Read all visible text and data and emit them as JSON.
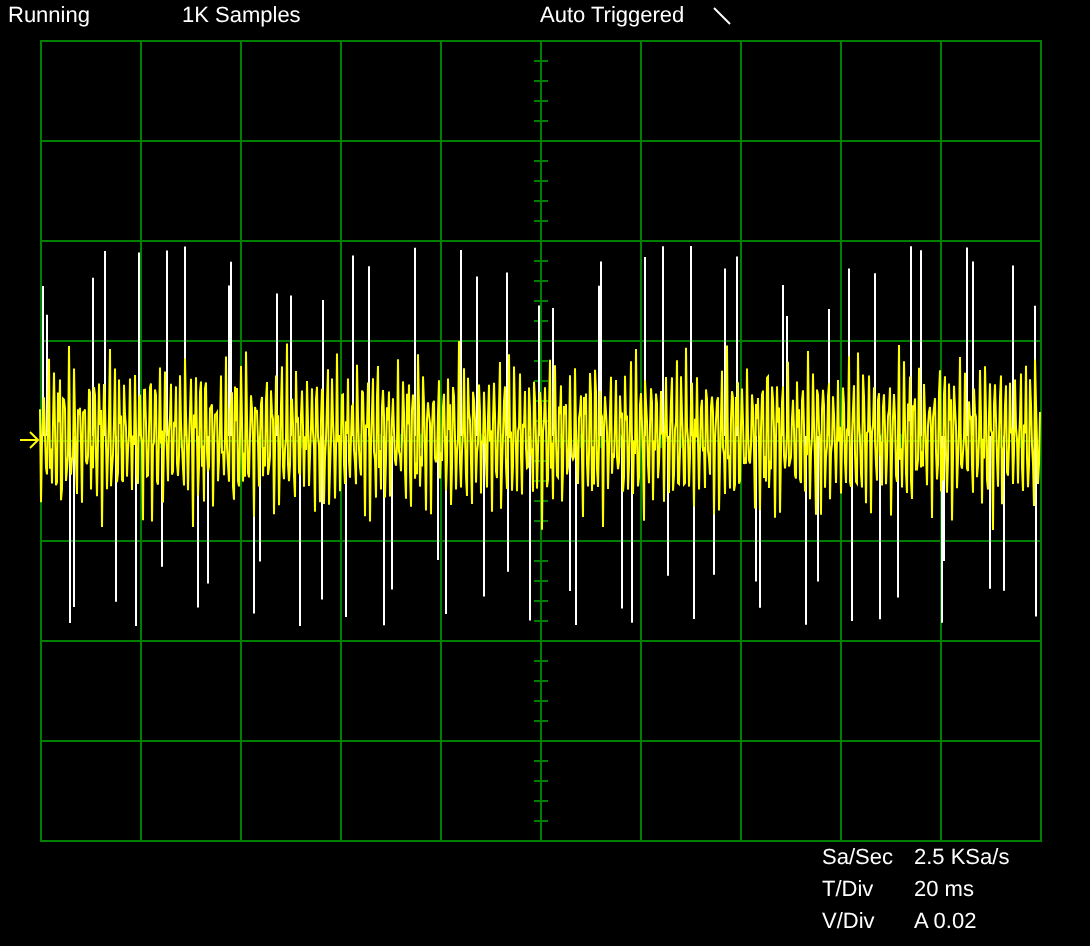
{
  "status_bar": {
    "run_state": "Running",
    "samples": "1K Samples",
    "trigger_mode": "Auto Triggered"
  },
  "readouts": [
    {
      "label": "Sa/Sec",
      "value": "2.5 KSa/s"
    },
    {
      "label": "T/Div",
      "value": "20 ms"
    },
    {
      "label": "V/Div",
      "value": "A 0.02"
    }
  ]
}
